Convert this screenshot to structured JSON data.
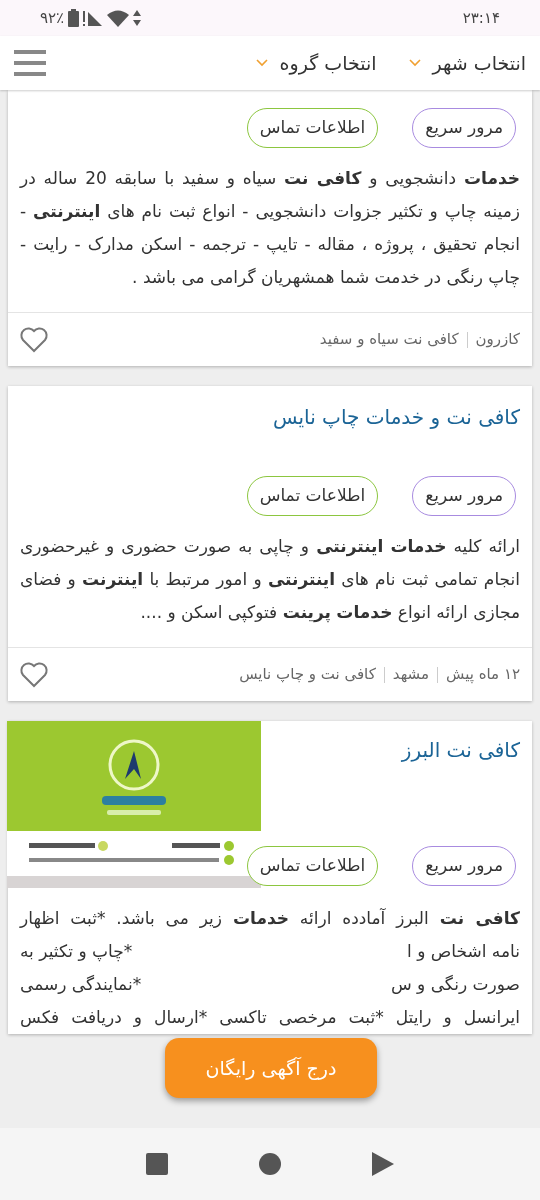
{
  "status_bar": {
    "time": "۲۳:۱۴",
    "battery": "۹۲٪"
  },
  "header": {
    "filters": [
      {
        "label": "انتخاب شهر"
      },
      {
        "label": "انتخاب گروه"
      }
    ]
  },
  "listings": [
    {
      "kind": "text",
      "actions": [
        {
          "label": "مرور سریع",
          "color": "#a88be0"
        },
        {
          "label": "اطلاعات تماس",
          "color": "#8cc63f"
        }
      ],
      "description": "**خدمات** دانشجویی و **کافی نت** سیاه و سفید با سابقه 20 ساله در زمینه چاپ و تکثیر جزوات دانشجویی - انواع ثبت نام های **اینترنتی** - انجام تحقیق ، پروژه ، مقاله - تایپ - ترجمه - اسکن مدارک - رایت - چاپ رنگی در خدمت شما همشهریان گرامی می باشد .",
      "meta": [
        "کازرون",
        "کافی نت سیاه و سفید"
      ],
      "favorite": false
    },
    {
      "kind": "text",
      "title": "کافی نت و خدمات چاپ نایس",
      "actions": [
        {
          "label": "مرور سریع",
          "color": "#a88be0"
        },
        {
          "label": "اطلاعات تماس",
          "color": "#8cc63f"
        }
      ],
      "description": "ارائه کلیه **خدمات** **اینترنتی** و چاپی به صورت حضوری و غیرحضوری انجام تمامی ثبت نام های **اینترنتی** و امور مرتبط با **اینترنت** و فضای مجازی ارائه انواع **خدمات** **پرینت** فتوکپی اسکن و ....",
      "meta": [
        "۱۲ ماه پیش",
        "مشهد",
        "کافی نت و چاپ نایس"
      ],
      "favorite": false
    },
    {
      "kind": "picture",
      "title": "کافی نت البرز",
      "actions": [
        {
          "label": "مرور سریع",
          "color": "#a88be0"
        },
        {
          "label": "اطلاعات تماس",
          "color": "#8cc63f"
        }
      ],
      "description_lines": [
        {
          "segments": [
            "**کافی نت** البرز آمادده ارائه **خدمات** زیر می باشد. *ثبت اظهار"
          ]
        },
        {
          "segments": [
            "نامه اشخاص و ا",
            "*چاپ و تکثیر به"
          ]
        },
        {
          "segments": [
            "صورت رنگی و س",
            "*نمایندگی رسمی"
          ]
        },
        {
          "segments": [
            "ایرانسل و رایتل *ثبت مرخصی تاکسی *ارسال و دریافت فکس"
          ]
        }
      ]
    }
  ],
  "floating_button": {
    "label": "درج آگهی رایگان"
  }
}
